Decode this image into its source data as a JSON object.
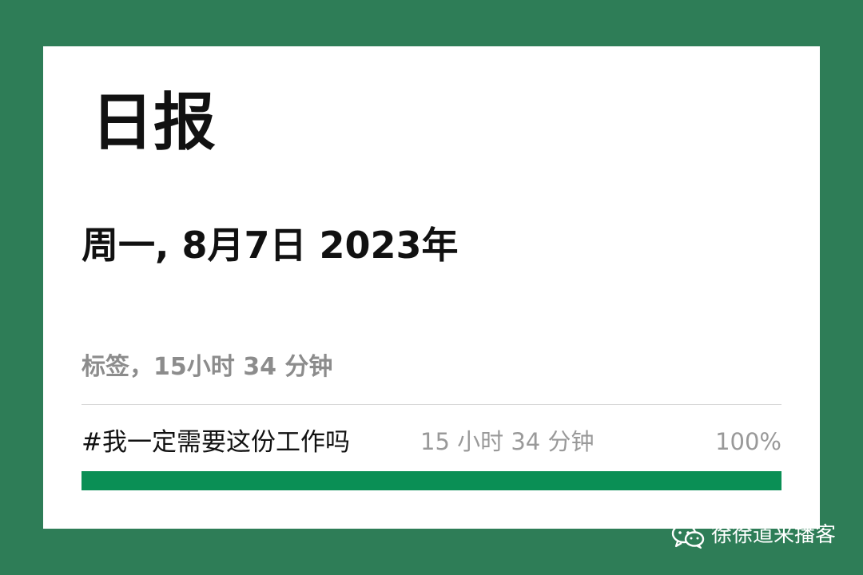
{
  "report": {
    "title": "日报",
    "date": "周一, 8月7日 2023年",
    "summary": "标签，15小时 34 分钟",
    "tag": {
      "name": "#我一定需要这份工作吗",
      "duration": "15 小时 34 分钟",
      "percent_label": "100%",
      "percent": 100
    }
  },
  "watermark": {
    "text": "徐徐道来播客",
    "icon": "wechat-icon"
  },
  "colors": {
    "background": "#2e7d57",
    "progress": "#0a8f55"
  }
}
